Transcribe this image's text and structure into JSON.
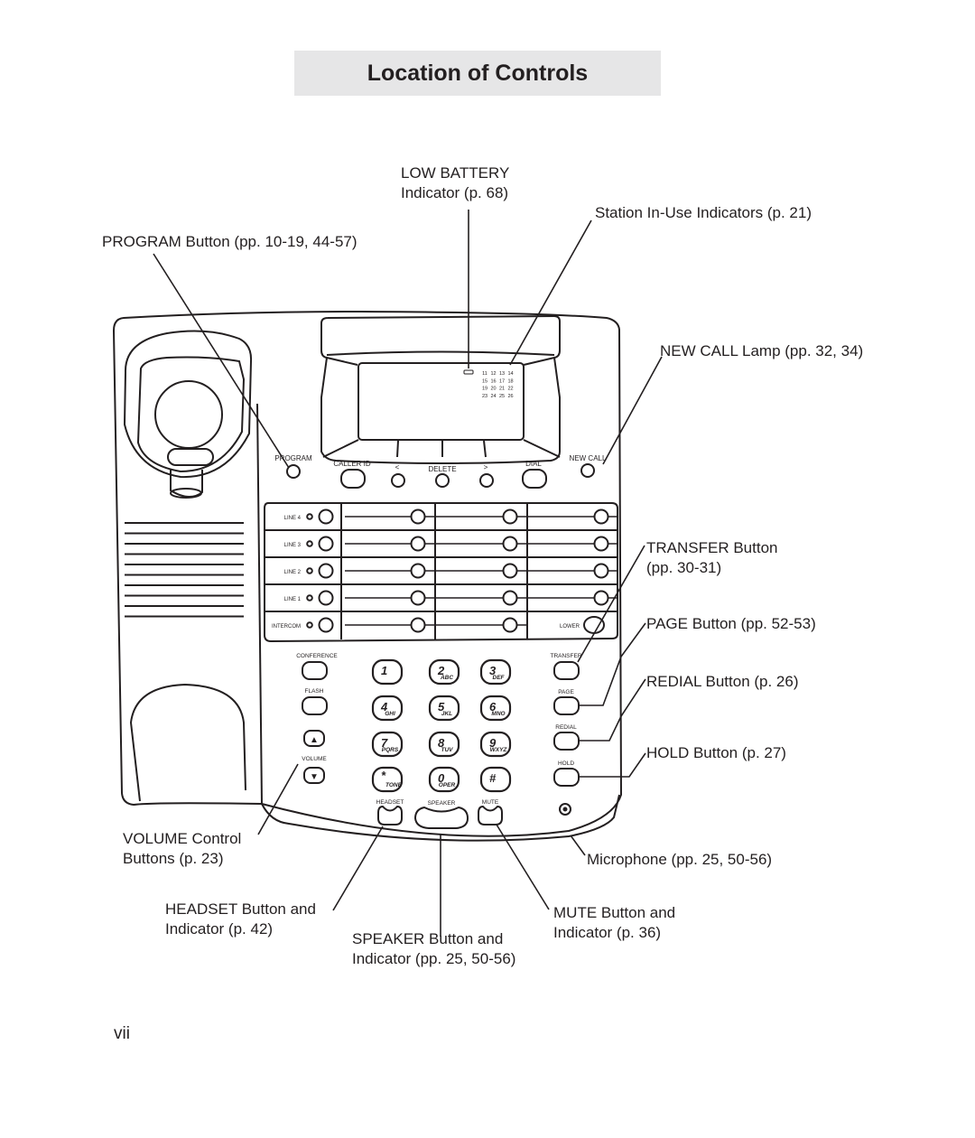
{
  "page": {
    "title": "Location of Controls",
    "page_number": "vii"
  },
  "callouts": {
    "low_battery": [
      "LOW BATTERY",
      "Indicator (p. 68)"
    ],
    "station_in_use": [
      "Station In-Use Indicators (p. 21)"
    ],
    "program": [
      "PROGRAM Button (pp. 10-19, 44-57)"
    ],
    "new_call": [
      "NEW CALL Lamp (pp. 32, 34)"
    ],
    "transfer": [
      "TRANSFER Button",
      "(pp. 30-31)"
    ],
    "page": [
      "PAGE Button (pp. 52-53)"
    ],
    "redial": [
      "REDIAL Button (p. 26)"
    ],
    "hold": [
      "HOLD Button (p. 27)"
    ],
    "volume": [
      "VOLUME Control",
      "Buttons (p. 23)"
    ],
    "microphone": [
      "Microphone (pp. 25, 50-56)"
    ],
    "headset": [
      "HEADSET Button and",
      "Indicator (p. 42)"
    ],
    "speaker": [
      "SPEAKER Button and",
      "Indicator (pp. 25, 50-56)"
    ],
    "mute": [
      "MUTE Button and",
      "Indicator (p. 36)"
    ]
  },
  "phone": {
    "display": {
      "station_numbers": [
        [
          "11",
          "12",
          "13",
          "14"
        ],
        [
          "15",
          "16",
          "17",
          "18"
        ],
        [
          "19",
          "20",
          "21",
          "22"
        ],
        [
          "23",
          "24",
          "25",
          "26"
        ]
      ]
    },
    "top_row": {
      "program": "PROGRAM",
      "caller_id": "CALLER ID",
      "left": "<",
      "delete": "DELETE",
      "right": ">",
      "dial": "DIAL",
      "new_call": "NEW CALL"
    },
    "lines": [
      "LINE 4",
      "LINE 3",
      "LINE 2",
      "LINE 1",
      "INTERCOM"
    ],
    "lower": "LOWER",
    "left_column": {
      "conference": "CONFERENCE",
      "flash": "FLASH",
      "volume": "VOLUME",
      "volume_up_glyph": "▲",
      "volume_down_glyph": "▼"
    },
    "right_column": {
      "transfer": "TRANSFER",
      "page": "PAGE",
      "redial": "REDIAL",
      "hold": "HOLD"
    },
    "keypad": [
      {
        "num": "1",
        "sub": ""
      },
      {
        "num": "2",
        "sub": "ABC"
      },
      {
        "num": "3",
        "sub": "DEF"
      },
      {
        "num": "4",
        "sub": "GHI"
      },
      {
        "num": "5",
        "sub": "JKL"
      },
      {
        "num": "6",
        "sub": "MNO"
      },
      {
        "num": "7",
        "sub": "PQRS"
      },
      {
        "num": "8",
        "sub": "TUV"
      },
      {
        "num": "9",
        "sub": "WXYZ"
      },
      {
        "num": "*",
        "sub": "TONE"
      },
      {
        "num": "0",
        "sub": "OPER"
      },
      {
        "num": "#",
        "sub": ""
      }
    ],
    "bottom_row": {
      "headset": "HEADSET",
      "speaker": "SPEAKER",
      "mute": "MUTE"
    }
  }
}
